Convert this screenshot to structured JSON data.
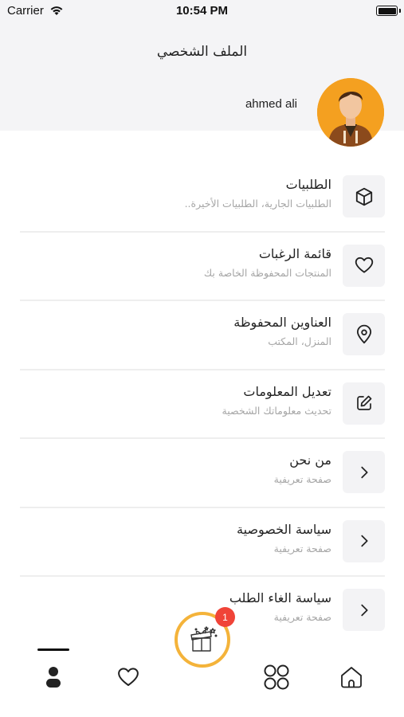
{
  "status_bar": {
    "carrier": "Carrier",
    "time": "10:54 PM"
  },
  "header": {
    "title": "الملف الشخصي",
    "user_name": "ahmed ali"
  },
  "menu": [
    {
      "title": "الطلبيات",
      "subtitle": "الطلبيات الجارية، الطلبيات الأخيرة..",
      "icon": "box-icon"
    },
    {
      "title": "قائمة الرغبات",
      "subtitle": "المنتجات المحفوظة الخاصة بك",
      "icon": "heart-icon"
    },
    {
      "title": "العناوين المحفوظة",
      "subtitle": "المنزل، المكتب",
      "icon": "location-pin-icon"
    },
    {
      "title": "تعديل المعلومات",
      "subtitle": "تحديث معلوماتك الشخصية",
      "icon": "edit-icon"
    },
    {
      "title": "من نحن",
      "subtitle": "صفحة تعريفية",
      "icon": "chevron-right-icon"
    },
    {
      "title": "سياسة الخصوصية",
      "subtitle": "صفحة تعريفية",
      "icon": "chevron-right-icon"
    },
    {
      "title": "سياسة الغاء الطلب",
      "subtitle": "صفحة تعريفية",
      "icon": "chevron-right-icon"
    }
  ],
  "tab_bar": {
    "tabs": [
      "profile-tab",
      "wishlist-tab",
      "categories-tab",
      "home-tab"
    ],
    "active": "profile-tab",
    "gift_badge": "1"
  },
  "colors": {
    "accent": "#f4b33a",
    "badge": "#f04438",
    "header_bg": "#f4f4f6"
  }
}
